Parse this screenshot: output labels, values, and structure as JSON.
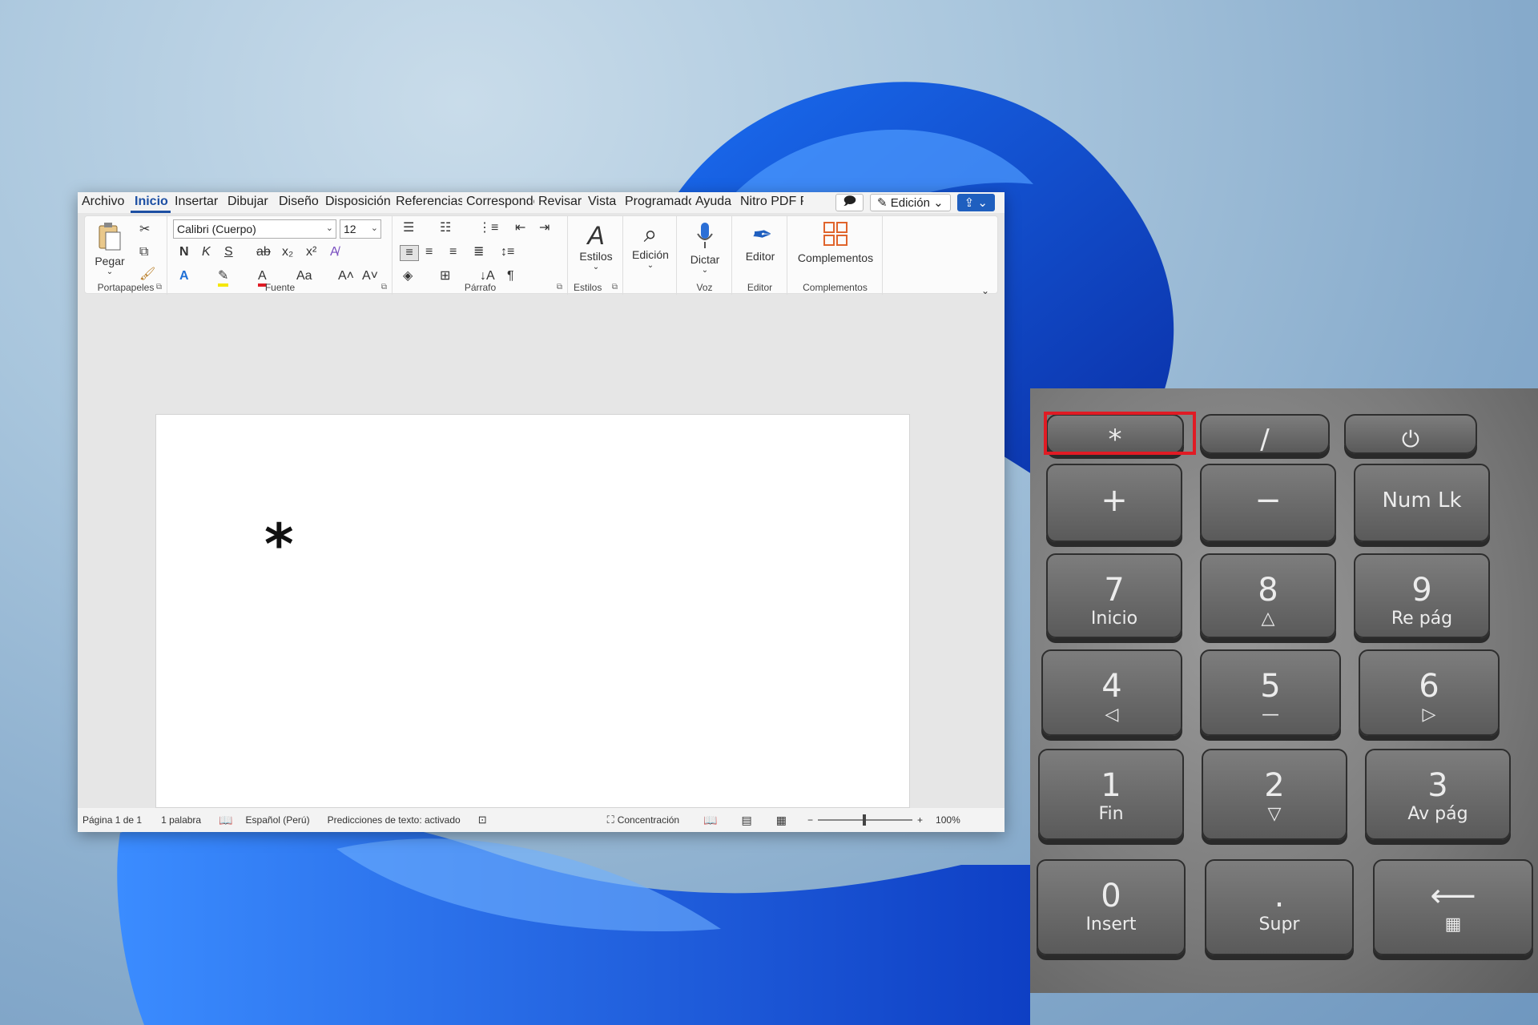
{
  "menu_tabs": [
    "Archivo",
    "Inicio",
    "Insertar",
    "Dibujar",
    "Diseño",
    "Disposición",
    "Referencias",
    "Correspondencia",
    "Revisar",
    "Vista",
    "Programador",
    "Ayuda",
    "Nitro PDF Pro"
  ],
  "active_tab": "Inicio",
  "topbar": {
    "mode_label": "Edición"
  },
  "ribbon": {
    "clipboard": {
      "paste_label": "Pegar",
      "group_label": "Portapapeles"
    },
    "font": {
      "font_name": "Calibri (Cuerpo)",
      "font_size": "12",
      "bold": "N",
      "italic": "K",
      "underline": "S",
      "strike": "ab",
      "group_label": "Fuente",
      "case_label": "Aa"
    },
    "paragraph": {
      "group_label": "Párrafo"
    },
    "styles": {
      "button_label": "Estilos",
      "group_label": "Estilos"
    },
    "editing": {
      "button_label": "Edición"
    },
    "voice": {
      "button_label": "Dictar",
      "group_label": "Voz"
    },
    "editor": {
      "button_label": "Editor",
      "group_label": "Editor"
    },
    "addins": {
      "button_label": "Complementos",
      "group_label": "Complementos"
    }
  },
  "document": {
    "text": "*"
  },
  "statusbar": {
    "page": "Página 1 de 1",
    "words": "1 palabra",
    "language": "Español (Perú)",
    "predictions": "Predicciones de texto: activado",
    "focus": "Concentración",
    "zoom": "100%"
  },
  "keypad": {
    "keys": [
      {
        "main": "*",
        "sub": ""
      },
      {
        "main": "/",
        "sub": ""
      },
      {
        "main": "⏻",
        "sub": ""
      },
      {
        "main": "+",
        "sub": ""
      },
      {
        "main": "−",
        "sub": ""
      },
      {
        "main": "Num Lk",
        "sub": ""
      },
      {
        "main": "7",
        "sub": "Inicio"
      },
      {
        "main": "8",
        "sub": "△"
      },
      {
        "main": "9",
        "sub": "Re pág"
      },
      {
        "main": "4",
        "sub": "◁"
      },
      {
        "main": "5",
        "sub": "—"
      },
      {
        "main": "6",
        "sub": "▷"
      },
      {
        "main": "1",
        "sub": "Fin"
      },
      {
        "main": "2",
        "sub": "▽"
      },
      {
        "main": "3",
        "sub": "Av pág"
      },
      {
        "main": "0",
        "sub": "Insert"
      },
      {
        "main": ".",
        "sub": "Supr"
      },
      {
        "main": "⟵",
        "sub": "▦"
      }
    ],
    "highlight_color": "#e01b24"
  },
  "colors": {
    "accent": "#1d4fa3",
    "highlight": "#e01b24"
  }
}
